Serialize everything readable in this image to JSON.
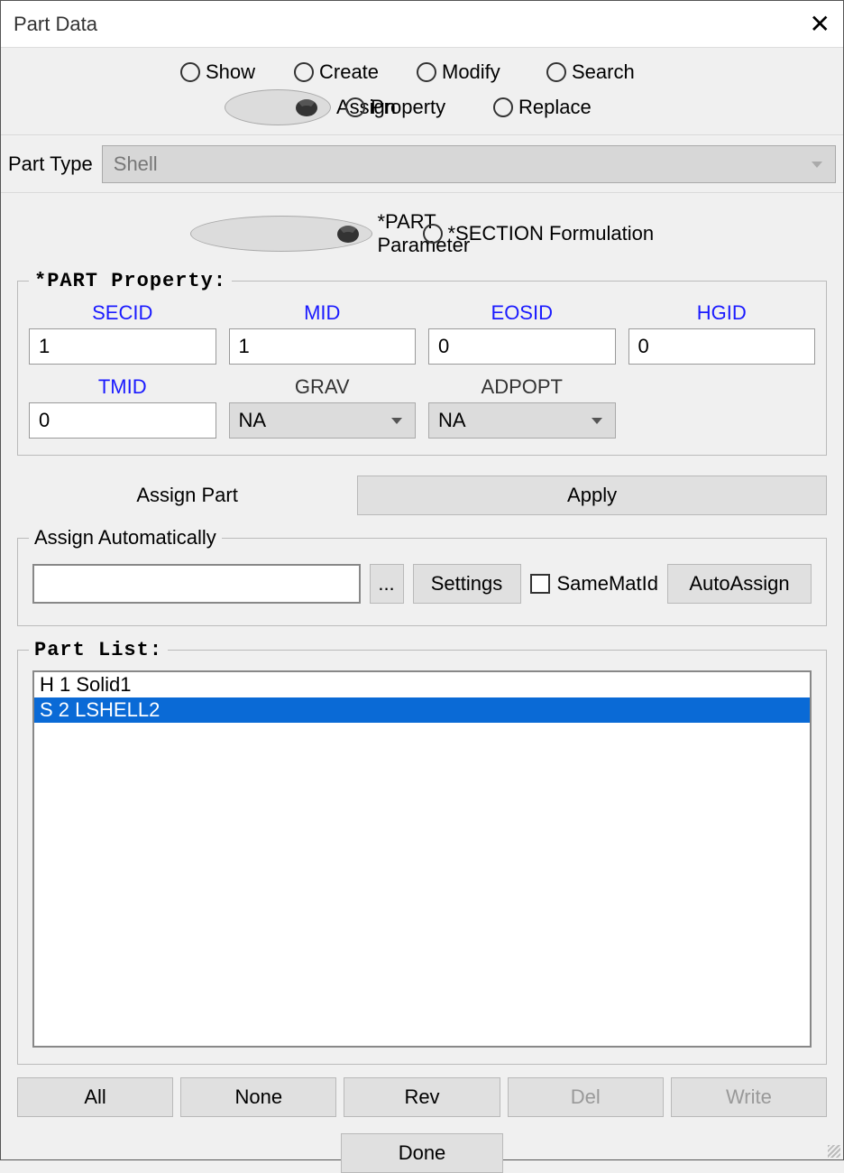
{
  "window": {
    "title": "Part Data"
  },
  "top_radios": {
    "row1": [
      {
        "label": "Show",
        "selected": false
      },
      {
        "label": "Create",
        "selected": false
      },
      {
        "label": "Modify",
        "selected": false
      },
      {
        "label": "Search",
        "selected": false
      }
    ],
    "row2": [
      {
        "label": "Assign",
        "selected": true
      },
      {
        "label": "Property",
        "selected": false
      },
      {
        "label": "Replace",
        "selected": false
      }
    ]
  },
  "part_type": {
    "label": "Part Type",
    "value": "Shell"
  },
  "param_radios": [
    {
      "label": "*PART Parameter",
      "selected": true
    },
    {
      "label": "*SECTION Formulation",
      "selected": false
    }
  ],
  "part_property": {
    "legend": "*PART Property:",
    "fields": [
      {
        "label": "SECID",
        "value": "1",
        "blue": true,
        "type": "text"
      },
      {
        "label": "MID",
        "value": "1",
        "blue": true,
        "type": "text"
      },
      {
        "label": "EOSID",
        "value": "0",
        "blue": true,
        "type": "text"
      },
      {
        "label": "HGID",
        "value": "0",
        "blue": true,
        "type": "text"
      },
      {
        "label": "TMID",
        "value": "0",
        "blue": true,
        "type": "text"
      },
      {
        "label": "GRAV",
        "value": "NA",
        "blue": false,
        "type": "select"
      },
      {
        "label": "ADPOPT",
        "value": "NA",
        "blue": false,
        "type": "select"
      }
    ]
  },
  "assign": {
    "label": "Assign Part",
    "apply": "Apply"
  },
  "auto": {
    "legend": "Assign Automatically",
    "browse": "...",
    "settings": "Settings",
    "samemat": "SameMatId",
    "autoassign": "AutoAssign",
    "path": ""
  },
  "part_list": {
    "legend": "Part List:",
    "items": [
      {
        "text": "H 1 Solid1",
        "selected": false
      },
      {
        "text": "S 2 LSHELL2",
        "selected": true
      }
    ]
  },
  "buttons": {
    "all": "All",
    "none": "None",
    "rev": "Rev",
    "del": "Del",
    "write": "Write",
    "done": "Done"
  }
}
